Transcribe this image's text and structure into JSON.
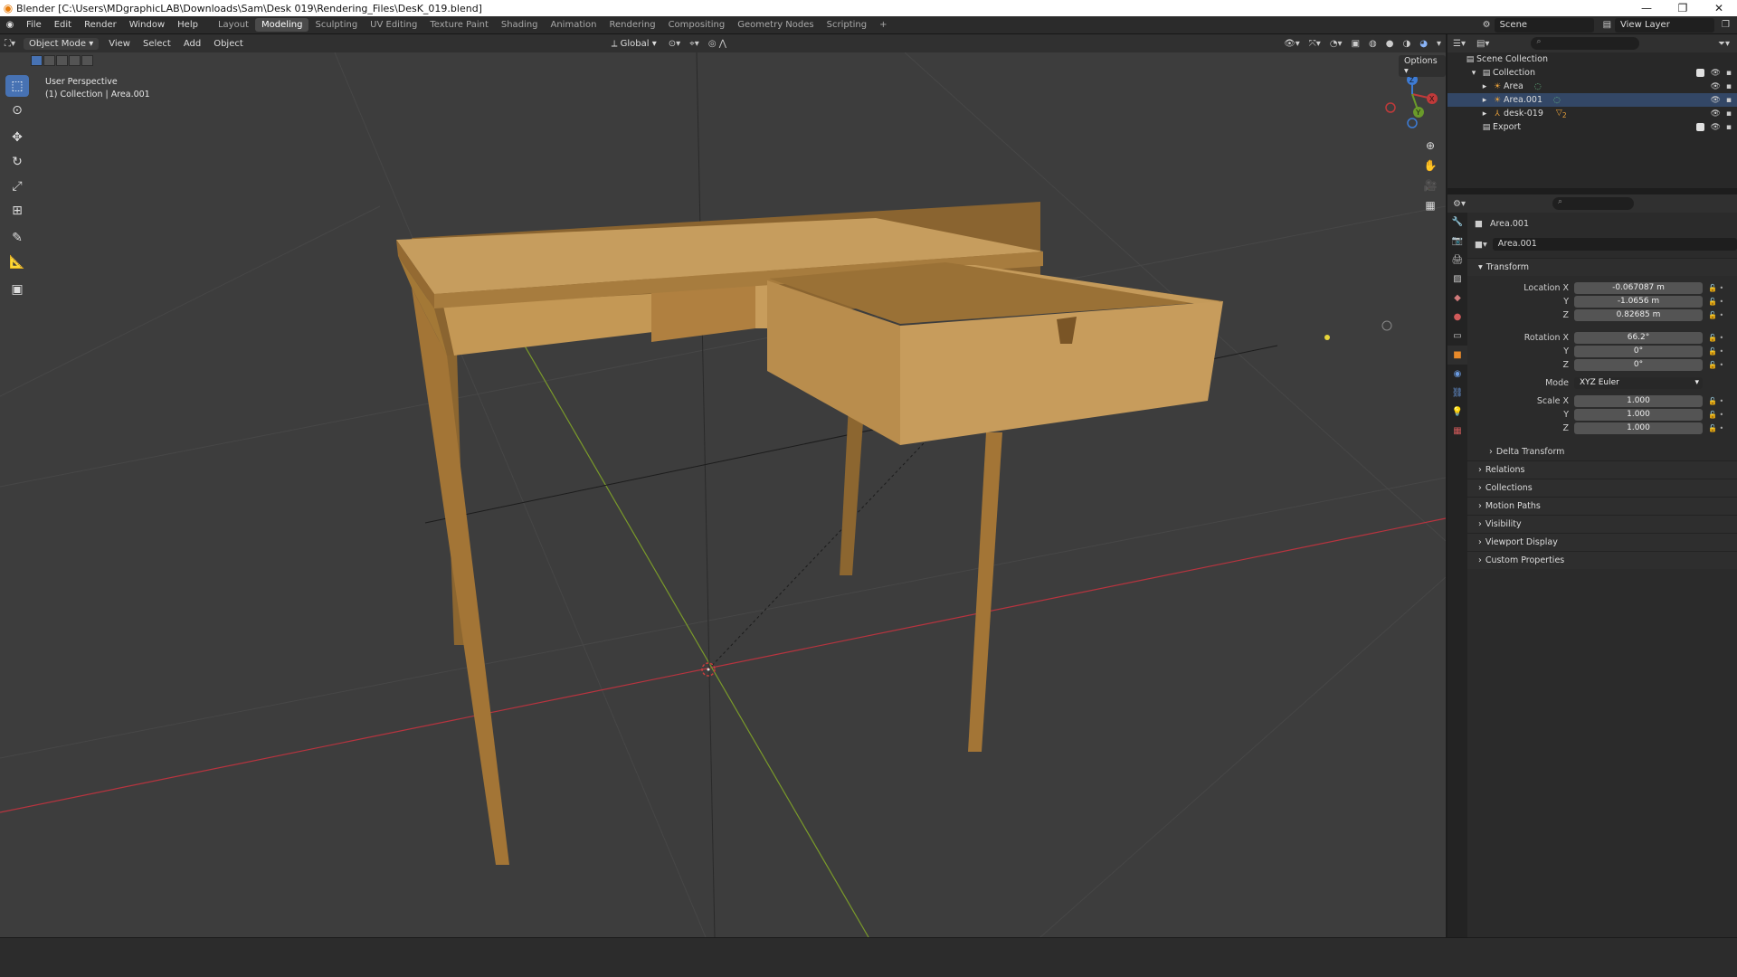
{
  "window": {
    "title": "Blender [C:\\Users\\MDgraphicLAB\\Downloads\\Sam\\Desk 019\\Rendering_Files\\DesK_019.blend]",
    "controls": [
      "—",
      "❐",
      "✕"
    ]
  },
  "menu": [
    "File",
    "Edit",
    "Render",
    "Window",
    "Help"
  ],
  "workspaces": {
    "items": [
      "Layout",
      "Modeling",
      "Sculpting",
      "UV Editing",
      "Texture Paint",
      "Shading",
      "Animation",
      "Rendering",
      "Compositing",
      "Geometry Nodes",
      "Scripting",
      "+"
    ],
    "active": "Modeling"
  },
  "scene": {
    "name": "Scene",
    "view_layer": "View Layer"
  },
  "viewport_header": {
    "mode": "Object Mode",
    "menus": [
      "View",
      "Select",
      "Add",
      "Object"
    ],
    "transform_orientation": "Global"
  },
  "viewport": {
    "perspective": "User Perspective",
    "collection_info": "(1) Collection | Area.001",
    "options": "Options",
    "gizmo": {
      "x": "X",
      "y": "Y",
      "z": "Z"
    }
  },
  "outliner": {
    "root": "Scene Collection",
    "rows": [
      {
        "label": "Collection",
        "icon": "collection-icon",
        "level": 1
      },
      {
        "label": "Area",
        "icon": "light-icon",
        "level": 2
      },
      {
        "label": "Area.001",
        "icon": "light-icon",
        "level": 2
      },
      {
        "label": "desk-019",
        "icon": "mesh-icon",
        "level": 2,
        "badge": "2"
      },
      {
        "label": "Export",
        "icon": "collection-icon",
        "level": 1
      }
    ]
  },
  "properties": {
    "object_name": "Area.001",
    "data_name": "Area.001",
    "transform_title": "Transform",
    "location": {
      "label": "Location X",
      "x": "-0.067087 m",
      "y": "-1.0656 m",
      "z": "0.82685 m"
    },
    "rotation": {
      "label": "Rotation X",
      "x": "66.2°",
      "y": "0°",
      "z": "0°"
    },
    "mode": {
      "label": "Mode",
      "value": "XYZ Euler"
    },
    "scale": {
      "label": "Scale X",
      "x": "1.000",
      "y": "1.000",
      "z": "1.000"
    },
    "axis_labels": {
      "y": "Y",
      "z": "Z"
    },
    "delta": "Delta Transform",
    "panels": [
      "Relations",
      "Collections",
      "Motion Paths",
      "Visibility",
      "Viewport Display",
      "Custom Properties"
    ]
  },
  "colors": {
    "accent": "#4772b3",
    "x_axis": "#b8343f",
    "y_axis": "#7a9a2a",
    "wood": "#b58947"
  }
}
